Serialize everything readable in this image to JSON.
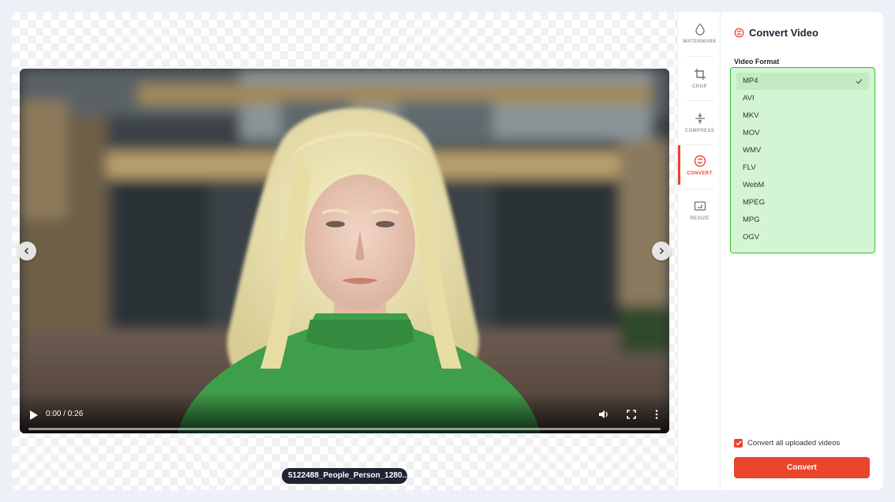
{
  "player": {
    "time": "0:00 / 0:26",
    "progress": 0,
    "filename": "5122488_People_Person_1280..."
  },
  "tools": [
    {
      "label": "WATERMARK",
      "icon": "droplet-icon"
    },
    {
      "label": "CROP",
      "icon": "crop-icon"
    },
    {
      "label": "COMPRESS",
      "icon": "compress-icon"
    },
    {
      "label": "CONVERT",
      "icon": "convert-icon",
      "active": true
    },
    {
      "label": "RESIZE",
      "icon": "resize-icon"
    }
  ],
  "panel": {
    "title": "Convert Video",
    "format_label": "Video Format",
    "formats": [
      "MP4",
      "AVI",
      "MKV",
      "MOV",
      "WMV",
      "FLV",
      "WebM",
      "MPEG",
      "MPG",
      "OGV"
    ],
    "selected_format": "MP4",
    "convert_all_label": "Convert all uploaded videos",
    "convert_all_checked": true,
    "convert_button": "Convert"
  },
  "colors": {
    "accent": "#e8452c",
    "dropdown_highlight": "#d4f5d4",
    "dropdown_border": "#2ec42e",
    "pill": "#1d2533"
  }
}
